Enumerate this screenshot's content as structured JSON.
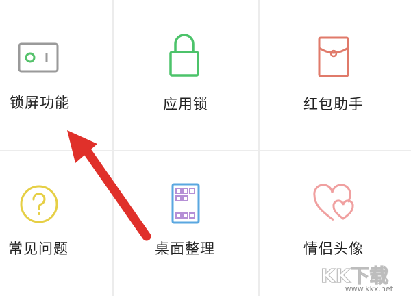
{
  "tiles": [
    {
      "label": "锁屏功能",
      "icon": "lock-screen-toggle-icon",
      "color": "#9a9a9a",
      "accent": "#55c26b"
    },
    {
      "label": "应用锁",
      "icon": "padlock-icon",
      "color": "#4cc36a"
    },
    {
      "label": "红包助手",
      "icon": "red-envelope-icon",
      "color": "#e07a6a"
    },
    {
      "label": "常见问题",
      "icon": "question-icon",
      "color": "#e6cf45"
    },
    {
      "label": "桌面整理",
      "icon": "desktop-organize-icon",
      "color": "#5aa7e0",
      "accent": "#b58fd6"
    },
    {
      "label": "情侣头像",
      "icon": "double-heart-icon",
      "color": "#f0a0a0"
    }
  ],
  "watermark": {
    "brand": "KK下载",
    "url": "www.kkx.net"
  },
  "colors": {
    "arrow": "#e0302a",
    "divider": "#ececec"
  }
}
